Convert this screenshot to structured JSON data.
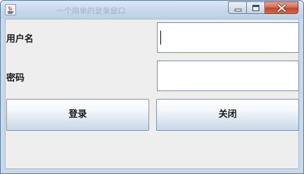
{
  "window": {
    "title": "一个简单的登录窗口",
    "controls": {
      "minimize_icon": "minimize-icon",
      "maximize_icon": "maximize-icon",
      "close_icon": "close-icon"
    },
    "app_icon": "java-coffee-icon"
  },
  "form": {
    "username_label": "用户名",
    "password_label": "密码",
    "username_value": "",
    "password_value": ""
  },
  "buttons": {
    "login_label": "登录",
    "close_label": "关闭"
  },
  "colors": {
    "client_background": "#eeeeee",
    "close_button": "#c0442a"
  }
}
